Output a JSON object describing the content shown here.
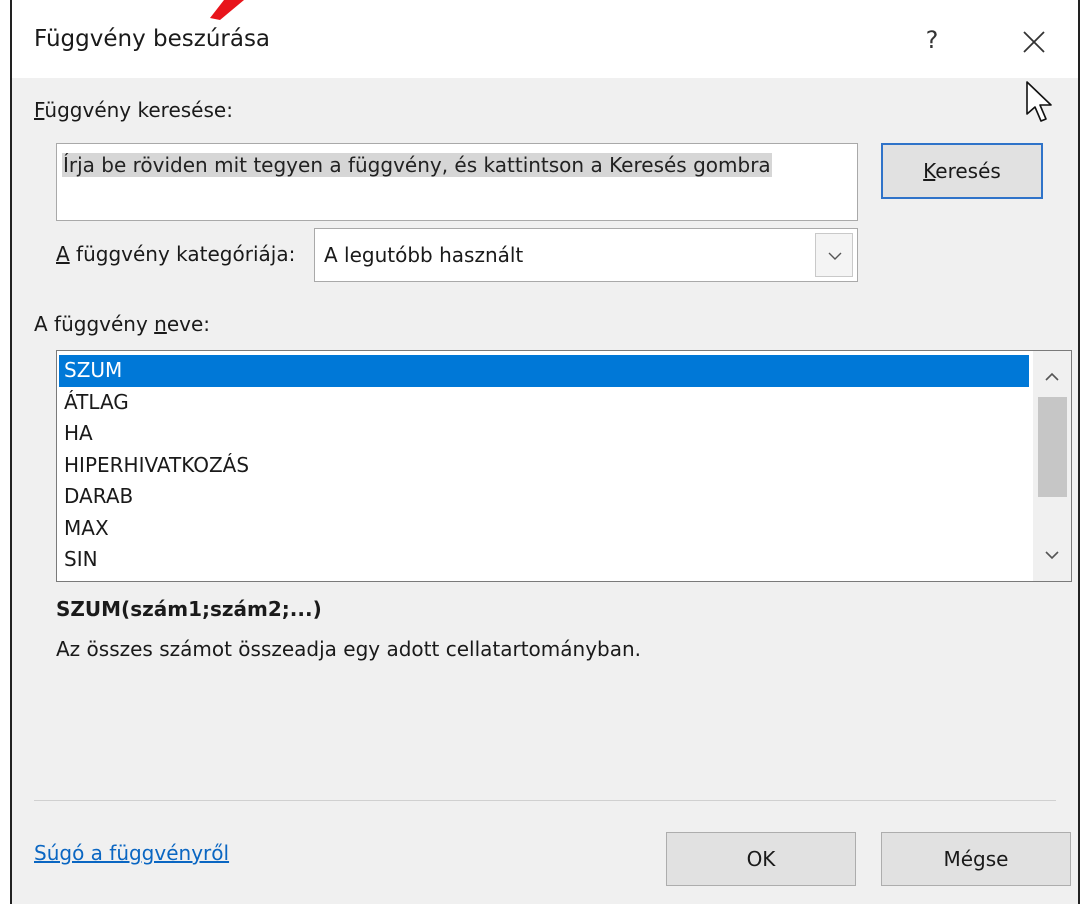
{
  "dialog": {
    "title": "Függvény beszúrása",
    "help_glyph": "?",
    "close_glyph": "✕"
  },
  "search": {
    "label_accel": "F",
    "label_rest": "üggvény keresése:",
    "text": "Írja be röviden mit tegyen a függvény, és kattintson a Keresés gombra",
    "button_accel": "K",
    "button_rest": "eresés"
  },
  "category": {
    "label_accel": "A",
    "label_rest": " függvény kategóriája:",
    "selected": "A legutóbb használt"
  },
  "function_list": {
    "label_before": "A függvény ",
    "label_accel": "n",
    "label_after": "eve:",
    "items": [
      "SZUM",
      "ÁTLAG",
      "HA",
      "HIPERHIVATKOZÁS",
      "DARAB",
      "MAX",
      "SIN"
    ],
    "selected_index": 0,
    "scroll_position": 0
  },
  "details": {
    "syntax": "SZUM(szám1;szám2;...)",
    "description": "Az összes számot összeadja egy adott cellatartományban."
  },
  "footer": {
    "help_link": "Súgó a függvényről",
    "ok_label": "OK",
    "cancel_label": "Mégse"
  },
  "colors": {
    "selection": "#0078d7",
    "link": "#0a66c2",
    "focus_border": "#2f73c9",
    "annotation_arrow": "#e8141b"
  }
}
